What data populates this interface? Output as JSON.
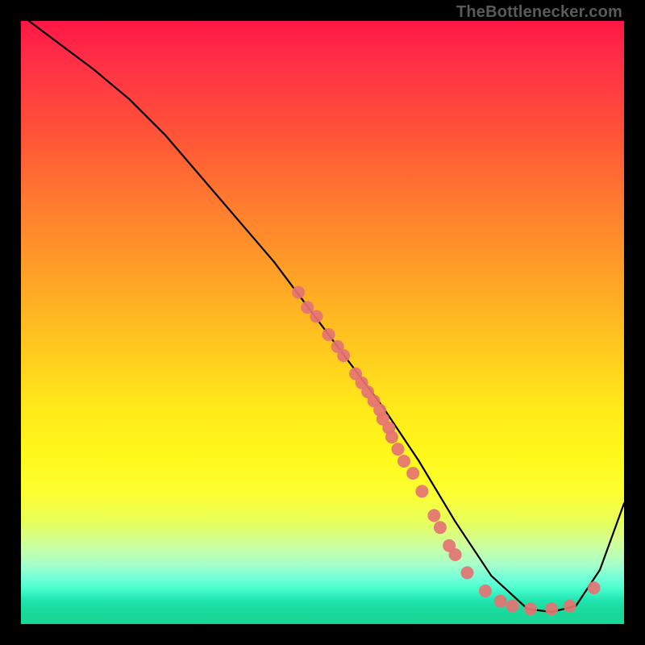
{
  "attribution": "TheBottlenecker.com",
  "chart_data": {
    "type": "line",
    "title": "",
    "xlabel": "",
    "ylabel": "",
    "xlim": [
      0,
      100
    ],
    "ylim": [
      0,
      100
    ],
    "grid": false,
    "legend": false,
    "gradient_stops": [
      {
        "pos": 0,
        "color": "#ff1744"
      },
      {
        "pos": 0.5,
        "color": "#ffdc1a"
      },
      {
        "pos": 0.95,
        "color": "#2effb0"
      },
      {
        "pos": 1.0,
        "color": "#18d696"
      }
    ],
    "series": [
      {
        "name": "curve",
        "x": [
          0,
          4,
          8,
          12,
          18,
          24,
          30,
          36,
          42,
          48,
          54,
          60,
          66,
          72,
          78,
          84,
          88,
          92,
          96,
          100
        ],
        "y": [
          101,
          98,
          95,
          92,
          87,
          81,
          74,
          67,
          60,
          52,
          44,
          36,
          27,
          17,
          8,
          2.5,
          2,
          3,
          9,
          20
        ]
      }
    ],
    "markers": {
      "name": "highlight-dots",
      "color": "#e57373",
      "points": [
        {
          "x": 46,
          "y": 55
        },
        {
          "x": 47.5,
          "y": 52.5
        },
        {
          "x": 49,
          "y": 51
        },
        {
          "x": 51,
          "y": 48
        },
        {
          "x": 52.5,
          "y": 46
        },
        {
          "x": 53.5,
          "y": 44.5
        },
        {
          "x": 55.5,
          "y": 41.5
        },
        {
          "x": 56.5,
          "y": 40
        },
        {
          "x": 57.5,
          "y": 38.5
        },
        {
          "x": 58.5,
          "y": 37
        },
        {
          "x": 59.5,
          "y": 35.5
        },
        {
          "x": 60,
          "y": 34
        },
        {
          "x": 61,
          "y": 32.5
        },
        {
          "x": 61.5,
          "y": 31
        },
        {
          "x": 62.5,
          "y": 29
        },
        {
          "x": 63.5,
          "y": 27
        },
        {
          "x": 65,
          "y": 25
        },
        {
          "x": 66.5,
          "y": 22
        },
        {
          "x": 68.5,
          "y": 18
        },
        {
          "x": 69.5,
          "y": 16
        },
        {
          "x": 71,
          "y": 13
        },
        {
          "x": 72,
          "y": 11.5
        },
        {
          "x": 74,
          "y": 8.5
        },
        {
          "x": 77,
          "y": 5.5
        },
        {
          "x": 79.5,
          "y": 3.8
        },
        {
          "x": 81.5,
          "y": 3
        },
        {
          "x": 84.5,
          "y": 2.5
        },
        {
          "x": 88,
          "y": 2.5
        },
        {
          "x": 91,
          "y": 3
        },
        {
          "x": 95,
          "y": 6
        }
      ]
    }
  }
}
